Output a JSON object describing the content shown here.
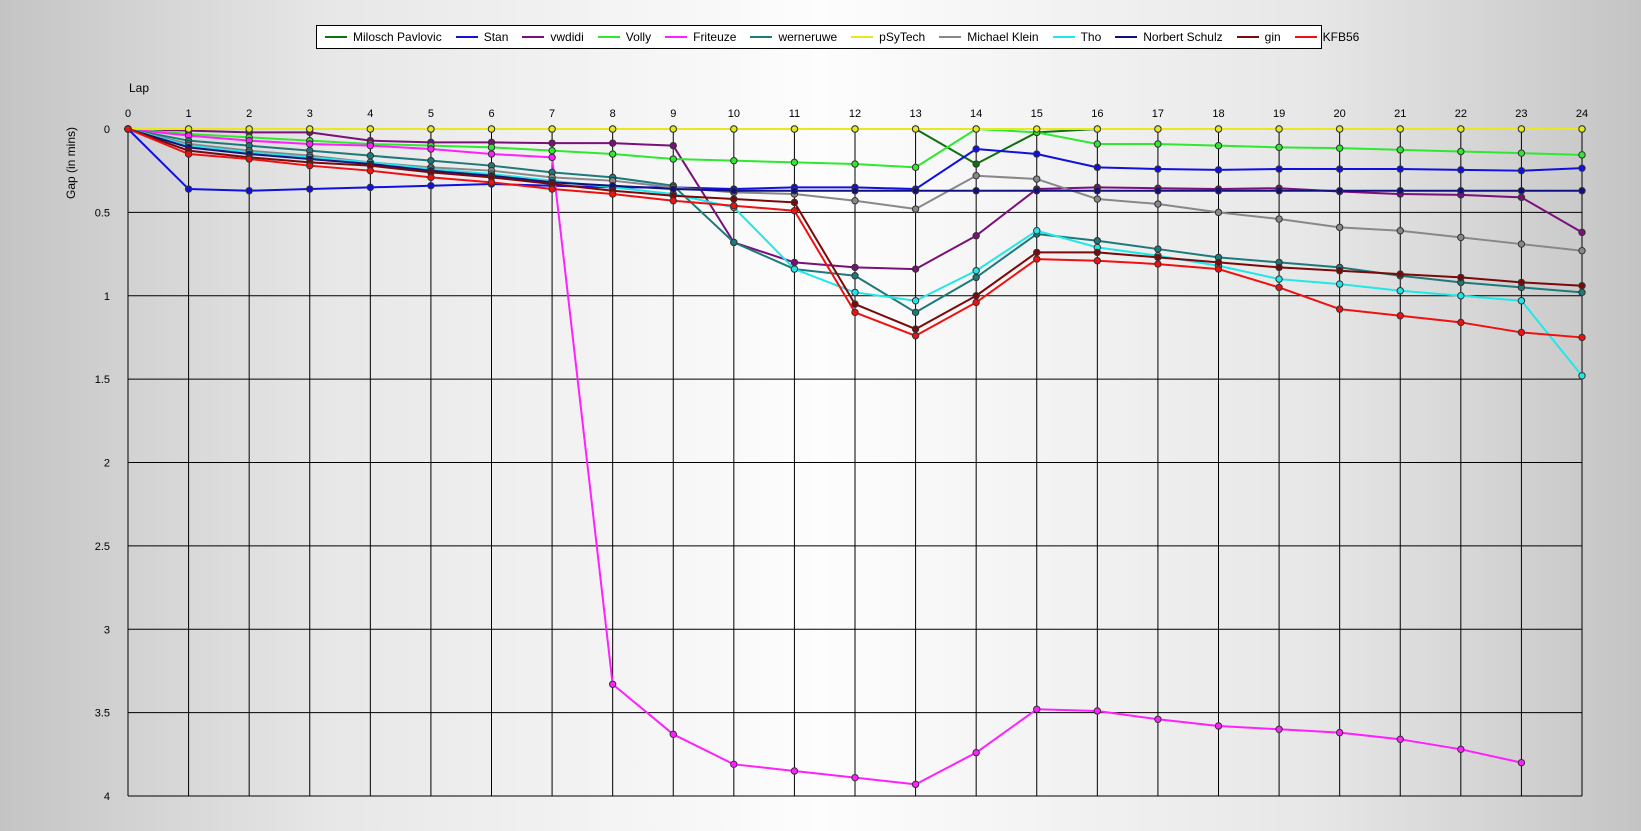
{
  "chart_data": {
    "type": "line",
    "xlabel": "Lap",
    "ylabel": "Gap (in mins)",
    "x": [
      0,
      1,
      2,
      3,
      4,
      5,
      6,
      7,
      8,
      9,
      10,
      11,
      12,
      13,
      14,
      15,
      16,
      17,
      18,
      19,
      20,
      21,
      22,
      23,
      24
    ],
    "xlim": [
      0,
      24
    ],
    "ylim": [
      0,
      4
    ],
    "y_inverted": true,
    "y_ticks": [
      "0",
      "0.5",
      "1",
      "1.5",
      "2",
      "2.5",
      "3",
      "3.5",
      "4"
    ],
    "grid": true,
    "legend_position": "top",
    "series": [
      {
        "name": "Milosch Pavlovic",
        "color": "#107010",
        "values": [
          0,
          0,
          0,
          0,
          0,
          0,
          0,
          0,
          0,
          0,
          0,
          0,
          0,
          0,
          0.21,
          0.02,
          0,
          0,
          0,
          0,
          0,
          0,
          0,
          0,
          0
        ]
      },
      {
        "name": "Stan",
        "color": "#1010e0",
        "values": [
          0,
          0.36,
          0.37,
          0.36,
          0.35,
          0.34,
          0.33,
          0.34,
          0.35,
          0.35,
          0.36,
          0.35,
          0.35,
          0.36,
          0.12,
          0.15,
          0.23,
          0.24,
          0.245,
          0.24,
          0.24,
          0.24,
          0.245,
          0.25,
          0.235
        ]
      },
      {
        "name": "vwdidi",
        "color": "#7a107a",
        "values": [
          0,
          0.01,
          0.02,
          0.02,
          0.07,
          0.08,
          0.08,
          0.085,
          0.085,
          0.1,
          0.68,
          0.8,
          0.83,
          0.84,
          0.64,
          0.36,
          0.35,
          0.355,
          0.36,
          0.355,
          0.375,
          0.39,
          0.395,
          0.41,
          0.62
        ]
      },
      {
        "name": "Volly",
        "color": "#2fe82f",
        "values": [
          0,
          0.03,
          0.05,
          0.07,
          0.09,
          0.1,
          0.11,
          0.13,
          0.15,
          0.18,
          0.19,
          0.2,
          0.21,
          0.23,
          0,
          0.02,
          0.09,
          0.09,
          0.1,
          0.11,
          0.115,
          0.125,
          0.135,
          0.145,
          0.155
        ]
      },
      {
        "name": "Friteuze",
        "color": "#ff20ff",
        "values": [
          0,
          0.04,
          0.07,
          0.09,
          0.1,
          0.12,
          0.15,
          0.17,
          3.33,
          3.63,
          3.81,
          3.85,
          3.89,
          3.93,
          3.74,
          3.48,
          3.49,
          3.54,
          3.58,
          3.6,
          3.62,
          3.66,
          3.72,
          3.8,
          null
        ]
      },
      {
        "name": "werneruwe",
        "color": "#1e7a7a",
        "values": [
          0,
          0.07,
          0.1,
          0.13,
          0.16,
          0.19,
          0.22,
          0.26,
          0.29,
          0.34,
          0.68,
          0.84,
          0.88,
          1.1,
          0.89,
          0.63,
          0.67,
          0.72,
          0.77,
          0.8,
          0.83,
          0.88,
          0.92,
          0.95,
          0.98
        ]
      },
      {
        "name": "pSyTech",
        "color": "#e8e820",
        "values": [
          0,
          0,
          0,
          0,
          0,
          0,
          0,
          0,
          0,
          0,
          0,
          0,
          0,
          0,
          0,
          0,
          0,
          0,
          0,
          0,
          0,
          0,
          0,
          0,
          0
        ]
      },
      {
        "name": "Michael Klein",
        "color": "#888888",
        "values": [
          0,
          0.09,
          0.13,
          0.16,
          0.2,
          0.23,
          0.25,
          0.29,
          0.31,
          0.35,
          0.38,
          0.39,
          0.43,
          0.48,
          0.28,
          0.3,
          0.42,
          0.45,
          0.5,
          0.54,
          0.59,
          0.61,
          0.65,
          0.69,
          0.73
        ]
      },
      {
        "name": "Tho",
        "color": "#20e8e8",
        "values": [
          0,
          0.1,
          0.14,
          0.17,
          0.2,
          0.24,
          0.27,
          0.31,
          0.35,
          0.39,
          0.47,
          0.84,
          0.98,
          1.03,
          0.85,
          0.61,
          0.71,
          0.76,
          0.82,
          0.9,
          0.93,
          0.97,
          1.0,
          1.03,
          1.48
        ]
      },
      {
        "name": "Norbert Schulz",
        "color": "#101080",
        "values": [
          0,
          0.11,
          0.15,
          0.18,
          0.21,
          0.25,
          0.28,
          0.32,
          0.34,
          0.36,
          0.37,
          0.37,
          0.37,
          0.37,
          0.37,
          0.37,
          0.37,
          0.37,
          0.37,
          0.37,
          0.37,
          0.37,
          0.37,
          0.37,
          0.37
        ]
      },
      {
        "name": "gin",
        "color": "#7a0a0a",
        "values": [
          0,
          0.13,
          0.17,
          0.2,
          0.22,
          0.26,
          0.29,
          0.33,
          0.37,
          0.4,
          0.42,
          0.44,
          1.05,
          1.2,
          1.0,
          0.74,
          0.74,
          0.77,
          0.8,
          0.83,
          0.85,
          0.87,
          0.89,
          0.92,
          0.94
        ]
      },
      {
        "name": "KFB56",
        "color": "#f01010",
        "values": [
          0,
          0.15,
          0.18,
          0.22,
          0.25,
          0.29,
          0.32,
          0.36,
          0.39,
          0.43,
          0.46,
          0.49,
          1.1,
          1.24,
          1.04,
          0.78,
          0.79,
          0.81,
          0.84,
          0.95,
          1.08,
          1.12,
          1.16,
          1.22,
          1.25
        ]
      }
    ]
  }
}
